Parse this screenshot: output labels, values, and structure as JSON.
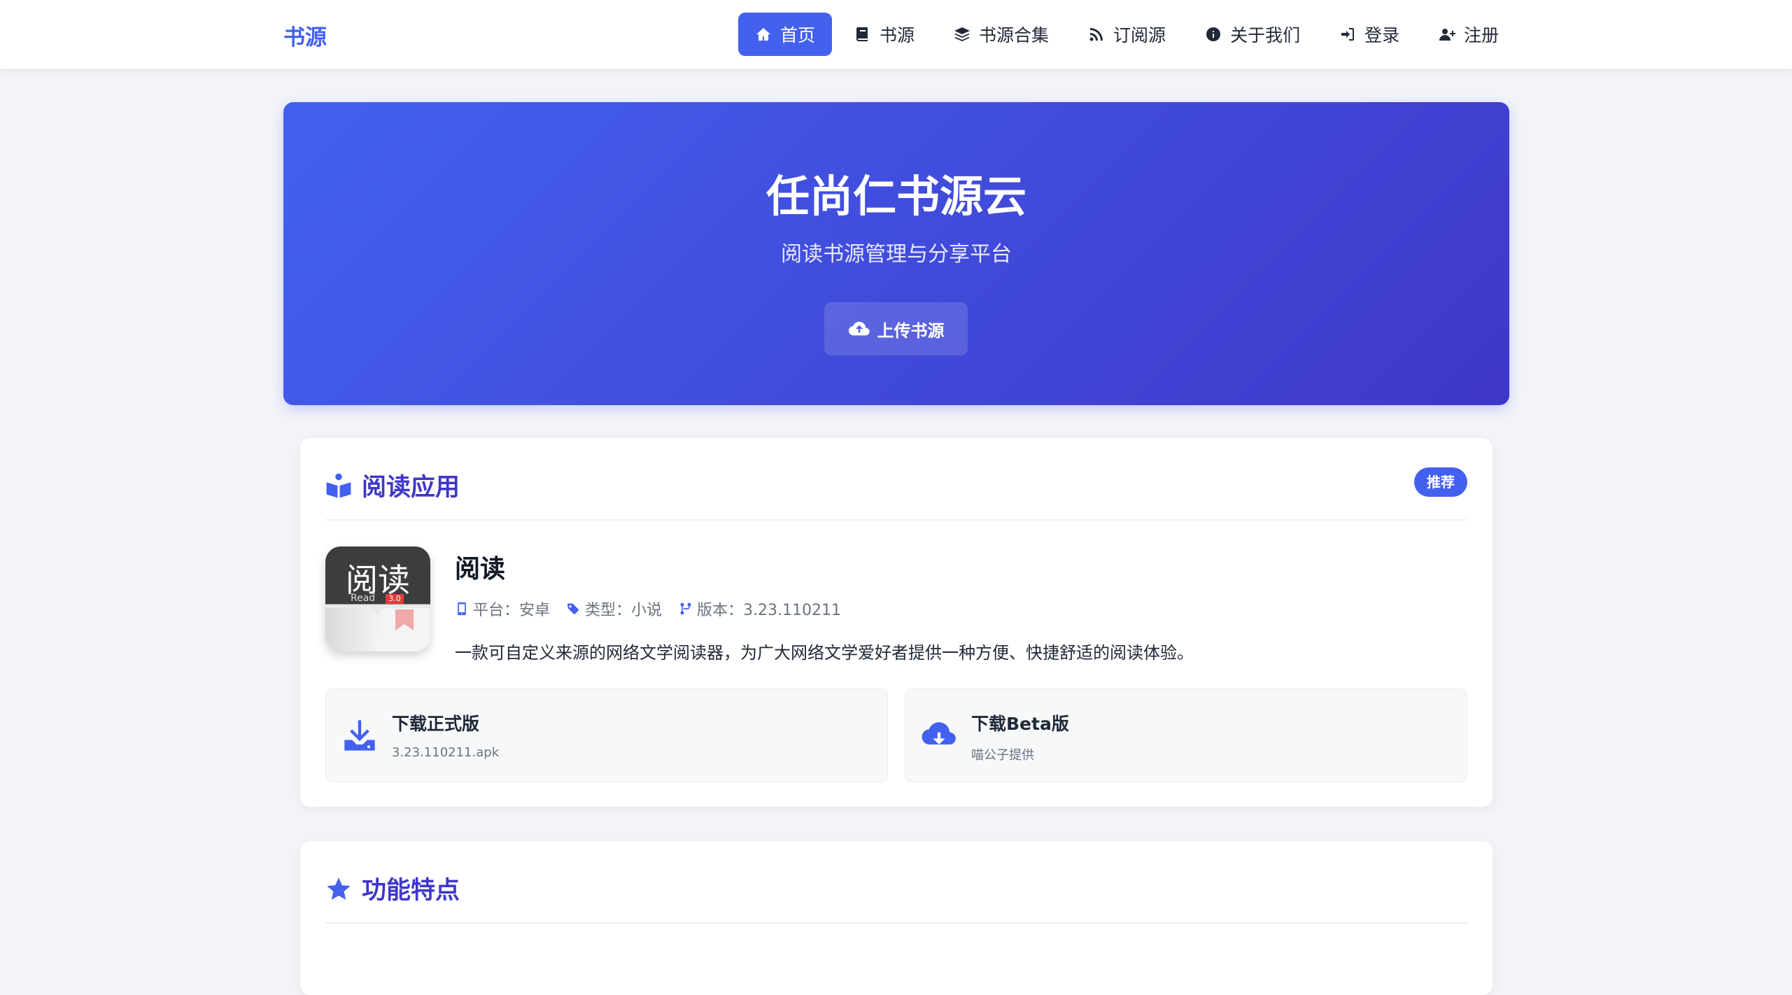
{
  "nav": {
    "brand": "书源",
    "items": [
      {
        "label": "首页",
        "icon": "home-icon",
        "active": true
      },
      {
        "label": "书源",
        "icon": "book-icon",
        "active": false
      },
      {
        "label": "书源合集",
        "icon": "layers-icon",
        "active": false
      },
      {
        "label": "订阅源",
        "icon": "rss-icon",
        "active": false
      },
      {
        "label": "关于我们",
        "icon": "info-icon",
        "active": false
      },
      {
        "label": "登录",
        "icon": "sign-in-icon",
        "active": false
      },
      {
        "label": "注册",
        "icon": "user-plus-icon",
        "active": false
      }
    ]
  },
  "hero": {
    "title": "任尚仁书源云",
    "subtitle": "阅读书源管理与分享平台",
    "upload_label": "上传书源"
  },
  "app_card": {
    "title": "阅读应用",
    "badge": "推荐",
    "logo_text": "阅读",
    "logo_sub": "Read",
    "logo_version": "3.0",
    "app_name": "阅读",
    "platform": "平台：安卓",
    "type": "类型：小说",
    "version": "版本：3.23.110211",
    "description": "一款可自定义来源的网络文学阅读器，为广大网络文学爱好者提供一种方便、快捷舒适的阅读体验。",
    "downloads": [
      {
        "title": "下载正式版",
        "sub": "3.23.110211.apk",
        "icon": "download-icon"
      },
      {
        "title": "下载Beta版",
        "sub": "喵公子提供",
        "icon": "cloud-download-icon"
      }
    ]
  },
  "features_card": {
    "title": "功能特点"
  },
  "colors": {
    "primary": "#4361ee",
    "primary_dark": "#3f37c9",
    "background": "#f3f4f8"
  }
}
